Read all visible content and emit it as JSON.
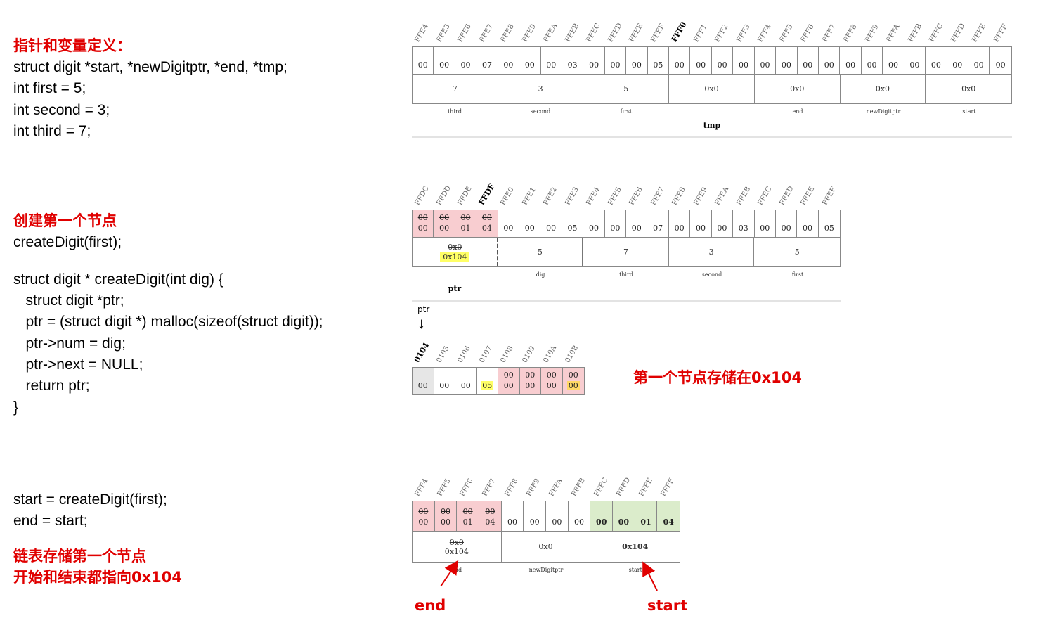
{
  "left": {
    "s1_title": "指针和变量定义：",
    "s1_code": [
      "struct digit *start, *newDigitptr, *end, *tmp;",
      "int first = 5;",
      "int second = 3;",
      "int third = 7;"
    ],
    "s2_title": "创建第一个节点",
    "s2_call": "createDigit(first);",
    "s2_code": [
      "struct digit * createDigit(int dig) {",
      "   struct digit *ptr;",
      "   ptr = (struct digit *) malloc(sizeof(struct digit));",
      "   ptr->num = dig;",
      "   ptr->next = NULL;",
      "   return ptr;",
      "}"
    ],
    "s3_code": [
      "start = createDigit(first);",
      "end = start;"
    ],
    "s3_title": [
      "链表存储第一个节点",
      "开始和结束都指向0x104"
    ]
  },
  "diagram1": {
    "addresses": [
      "FFE4",
      "FFE5",
      "FFE6",
      "FFE7",
      "FFE8",
      "FFE9",
      "FFEA",
      "FFEB",
      "FFEC",
      "FFED",
      "FFEE",
      "FFEF",
      "FFF0",
      "FFF1",
      "FFF2",
      "FFF3",
      "FFF4",
      "FFF5",
      "FFF6",
      "FFF7",
      "FFF8",
      "FFF9",
      "FFFA",
      "FFFB",
      "FFFC",
      "FFFD",
      "FFFE",
      "FFFF"
    ],
    "bold_address": "FFF0",
    "bytes": [
      "00",
      "00",
      "00",
      "07",
      "00",
      "00",
      "00",
      "03",
      "00",
      "00",
      "00",
      "05",
      "00",
      "00",
      "00",
      "00",
      "00",
      "00",
      "00",
      "00",
      "00",
      "00",
      "00",
      "00",
      "00",
      "00",
      "00",
      "00"
    ],
    "values": [
      "7",
      "3",
      "5",
      "0x0",
      "0x0",
      "0x0",
      "0x0"
    ],
    "names": [
      "third",
      "second",
      "first",
      "",
      "end",
      "newDigitptr",
      "start"
    ],
    "sublabel": "tmp"
  },
  "diagram2": {
    "addresses": [
      "FFDC",
      "FFDD",
      "FFDE",
      "FFDF",
      "FFE0",
      "FFE1",
      "FFE2",
      "FFE3",
      "FFE4",
      "FFE5",
      "FFE6",
      "FFE7",
      "FFE8",
      "FFE9",
      "FFEA",
      "FFEB",
      "FFEC",
      "FFED",
      "FFEE",
      "FFEF"
    ],
    "bold_address": "FFDF",
    "old_bytes": [
      "00",
      "00",
      "00",
      "00"
    ],
    "bytes": [
      "00",
      "00",
      "01",
      "04",
      "00",
      "00",
      "00",
      "05",
      "00",
      "00",
      "00",
      "07",
      "00",
      "00",
      "00",
      "03",
      "00",
      "00",
      "00",
      "05"
    ],
    "ptr_old": "0x0",
    "ptr_new": "0x104",
    "values": [
      "5",
      "7",
      "3",
      "5"
    ],
    "names": [
      "dig",
      "third",
      "second",
      "first"
    ],
    "sublabel": "ptr"
  },
  "heap": {
    "ptr_label": "ptr",
    "arrow": "↓",
    "addresses": [
      "0104",
      "0105",
      "0106",
      "0107",
      "0108",
      "0109",
      "010A",
      "010B"
    ],
    "bold_address": "0104",
    "old_bytes": [
      "00",
      "00",
      "00",
      "00"
    ],
    "bytes": [
      "00",
      "00",
      "00",
      "05",
      "00",
      "00",
      "00",
      "00"
    ],
    "note": "第一个节点存储在0x104"
  },
  "diagram3": {
    "addresses": [
      "FFF4",
      "FFF5",
      "FFF6",
      "FFF7",
      "FFF8",
      "FFF9",
      "FFFA",
      "FFFB",
      "FFFC",
      "FFFD",
      "FFFE",
      "FFFF"
    ],
    "old_bytes": [
      "00",
      "00",
      "00",
      "00"
    ],
    "bytes": [
      "00",
      "00",
      "01",
      "04",
      "00",
      "00",
      "00",
      "00",
      "00",
      "00",
      "01",
      "04"
    ],
    "end_old": "0x0",
    "values": [
      "0x104",
      "0x0",
      "0x104"
    ],
    "names": [
      "end",
      "newDigitptr",
      "start"
    ],
    "end_label": "end",
    "start_label": "start"
  },
  "colors": {
    "title_red": "#e00000",
    "pink": "#f8cdd0",
    "green": "#dbeccb",
    "yellow": "#ffff66"
  }
}
